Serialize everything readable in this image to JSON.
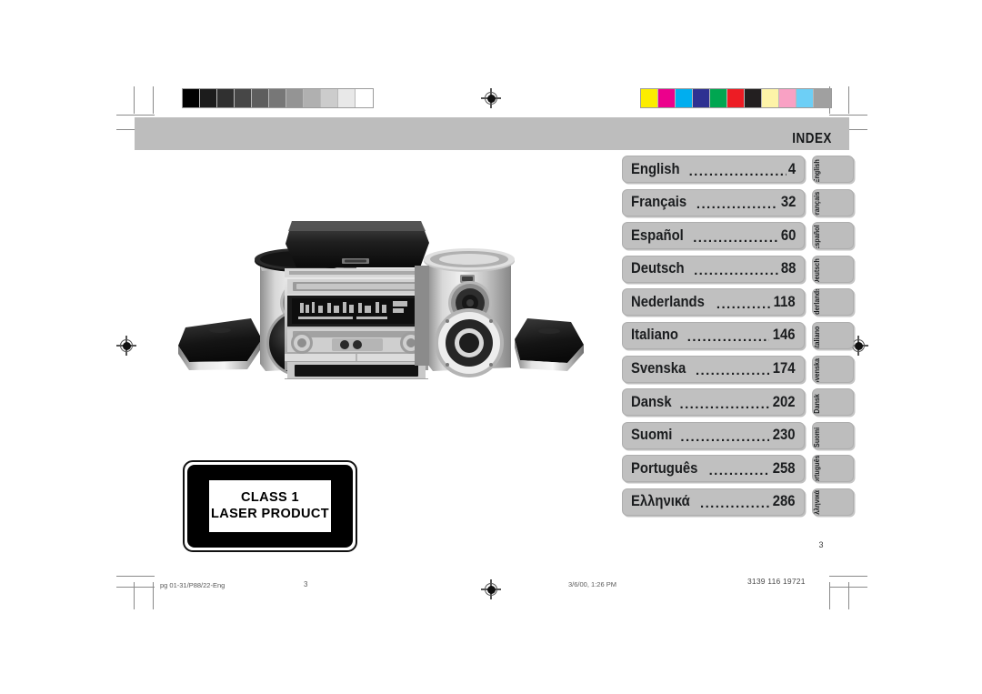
{
  "document": {
    "header_title": "INDEX",
    "page_number": "3"
  },
  "index": {
    "entries": [
      {
        "language": "English",
        "page": "4",
        "tab": "English"
      },
      {
        "language": "Français",
        "page": "32",
        "tab": "Français"
      },
      {
        "language": "Español",
        "page": "60",
        "tab": "Español"
      },
      {
        "language": "Deutsch",
        "page": "88",
        "tab": "Deutsch"
      },
      {
        "language": "Nederlands",
        "page": "118",
        "tab": "Nederlands"
      },
      {
        "language": "Italiano",
        "page": "146",
        "tab": "Italiano"
      },
      {
        "language": "Svenska",
        "page": "174",
        "tab": "Svenska"
      },
      {
        "language": "Dansk",
        "page": "202",
        "tab": "Dansk"
      },
      {
        "language": "Suomi",
        "page": "230",
        "tab": "Suomi"
      },
      {
        "language": "Português",
        "page": "258",
        "tab": "Português"
      },
      {
        "language": "Ελληνικά",
        "page": "286",
        "tab": "Ελληνικά"
      }
    ],
    "leader": "......................................................"
  },
  "laser_label": {
    "line1": "CLASS 1",
    "line2": "LASER PRODUCT"
  },
  "footer": {
    "file": "pg 01-31/P88/22-Eng",
    "page": "3",
    "date": "3/6/00, 1:26 PM",
    "doc_id": "3139 116 19721"
  },
  "print_marks": {
    "grayscale_bar": [
      "#000000",
      "#1c1c1c",
      "#303030",
      "#474747",
      "#5e5e5e",
      "#777777",
      "#949494",
      "#b0b0b0",
      "#cccccc",
      "#e8e8e8",
      "#ffffff"
    ],
    "color_bar": [
      "#fced00",
      "#ec008c",
      "#00aeef",
      "#2e3192",
      "#00a651",
      "#ed1c24",
      "#231f20",
      "#fdf3a8",
      "#f9a1c4",
      "#6dcff6",
      "#a0a0a0"
    ]
  },
  "colors": {
    "banner_gray": "#bdbdbd",
    "box_gray": "#c0c0c0",
    "text_dark": "#1b1d1f"
  }
}
